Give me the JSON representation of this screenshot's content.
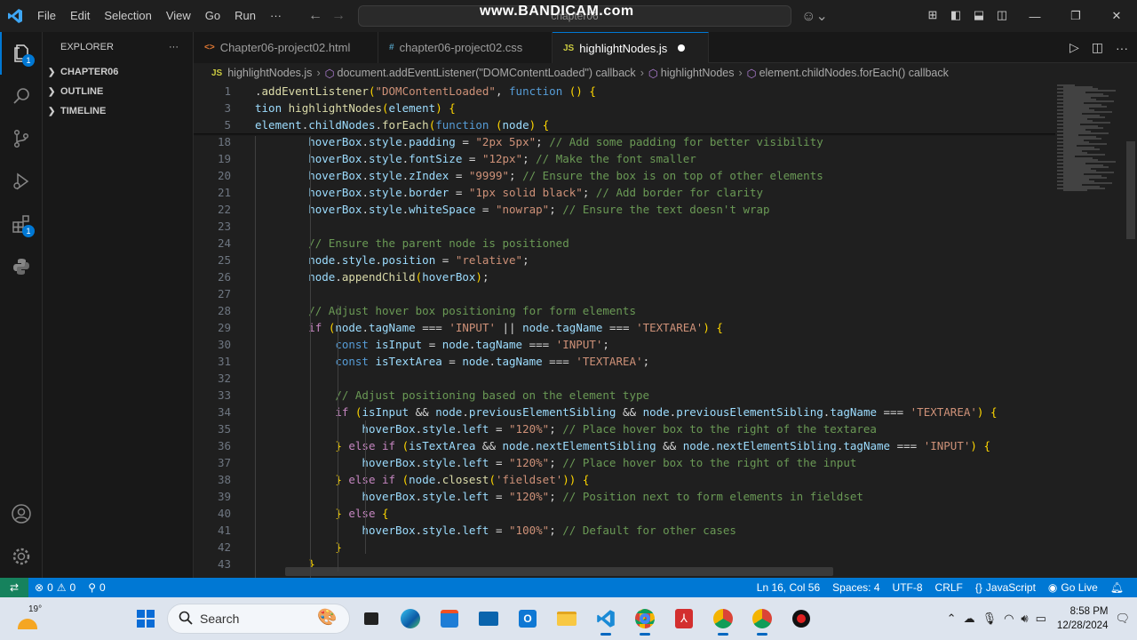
{
  "titlebar": {
    "menu": [
      "File",
      "Edit",
      "Selection",
      "View",
      "Go",
      "Run"
    ],
    "more": "···",
    "search_placeholder": "chapter06",
    "watermark": "www.BANDICAM.com"
  },
  "sidebar": {
    "title": "EXPLORER",
    "more": "···",
    "sections": [
      "CHAPTER06",
      "OUTLINE",
      "TIMELINE"
    ]
  },
  "activity": {
    "explorer_badge": "1",
    "extensions_badge": "1"
  },
  "tabs": [
    {
      "label": "Chapter06-project02.html",
      "icon": "<>"
    },
    {
      "label": "chapter06-project02.css",
      "icon": "#"
    },
    {
      "label": "highlightNodes.js",
      "icon": "JS"
    }
  ],
  "breadcrumb": {
    "file": "highlightNodes.js",
    "items": [
      "document.addEventListener(\"DOMContentLoaded\") callback",
      "highlightNodes",
      "element.childNodes.forEach() callback"
    ]
  },
  "editor": {
    "sticky": [
      {
        "n": "1",
        "t": ".addEventListener(\"DOMContentLoaded\", function () {"
      },
      {
        "n": "3",
        "t": "tion highlightNodes(element) {"
      },
      {
        "n": "5",
        "t": "element.childNodes.forEach(function (node) {"
      }
    ],
    "lines": [
      {
        "n": "18",
        "t": "        hoverBox.style.padding = \"2px 5px\"; // Add some padding for better visibility"
      },
      {
        "n": "19",
        "t": "        hoverBox.style.fontSize = \"12px\"; // Make the font smaller"
      },
      {
        "n": "20",
        "t": "        hoverBox.style.zIndex = \"9999\"; // Ensure the box is on top of other elements"
      },
      {
        "n": "21",
        "t": "        hoverBox.style.border = \"1px solid black\"; // Add border for clarity"
      },
      {
        "n": "22",
        "t": "        hoverBox.style.whiteSpace = \"nowrap\"; // Ensure the text doesn't wrap"
      },
      {
        "n": "23",
        "t": ""
      },
      {
        "n": "24",
        "t": "        // Ensure the parent node is positioned"
      },
      {
        "n": "25",
        "t": "        node.style.position = \"relative\";"
      },
      {
        "n": "26",
        "t": "        node.appendChild(hoverBox);"
      },
      {
        "n": "27",
        "t": ""
      },
      {
        "n": "28",
        "t": "        // Adjust hover box positioning for form elements"
      },
      {
        "n": "29",
        "t": "        if (node.tagName === 'INPUT' || node.tagName === 'TEXTAREA') {"
      },
      {
        "n": "30",
        "t": "            const isInput = node.tagName === 'INPUT';"
      },
      {
        "n": "31",
        "t": "            const isTextArea = node.tagName === 'TEXTAREA';"
      },
      {
        "n": "32",
        "t": ""
      },
      {
        "n": "33",
        "t": "            // Adjust positioning based on the element type"
      },
      {
        "n": "34",
        "t": "            if (isInput && node.previousElementSibling && node.previousElementSibling.tagName === 'TEXTAREA') {"
      },
      {
        "n": "35",
        "t": "                hoverBox.style.left = \"120%\"; // Place hover box to the right of the textarea"
      },
      {
        "n": "36",
        "t": "            } else if (isTextArea && node.nextElementSibling && node.nextElementSibling.tagName === 'INPUT') {"
      },
      {
        "n": "37",
        "t": "                hoverBox.style.left = \"120%\"; // Place hover box to the right of the input"
      },
      {
        "n": "38",
        "t": "            } else if (node.closest('fieldset')) {"
      },
      {
        "n": "39",
        "t": "                hoverBox.style.left = \"120%\"; // Position next to form elements in fieldset"
      },
      {
        "n": "40",
        "t": "            } else {"
      },
      {
        "n": "41",
        "t": "                hoverBox.style.left = \"100%\"; // Default for other cases"
      },
      {
        "n": "42",
        "t": "            }"
      },
      {
        "n": "43",
        "t": "        }"
      }
    ]
  },
  "statusbar": {
    "errors": "0",
    "warnings": "0",
    "ports": "0",
    "position": "Ln 16, Col 56",
    "spaces": "Spaces: 4",
    "encoding": "UTF-8",
    "eol": "CRLF",
    "language": "JavaScript",
    "golive": "Go Live"
  },
  "taskbar": {
    "temperature": "19°",
    "search": "Search",
    "time": "8:58 PM",
    "date": "12/28/2024"
  },
  "colors": {
    "accent": "#0078d4",
    "statusbar": "#0078d4",
    "editor_bg": "#1f1f1f"
  }
}
